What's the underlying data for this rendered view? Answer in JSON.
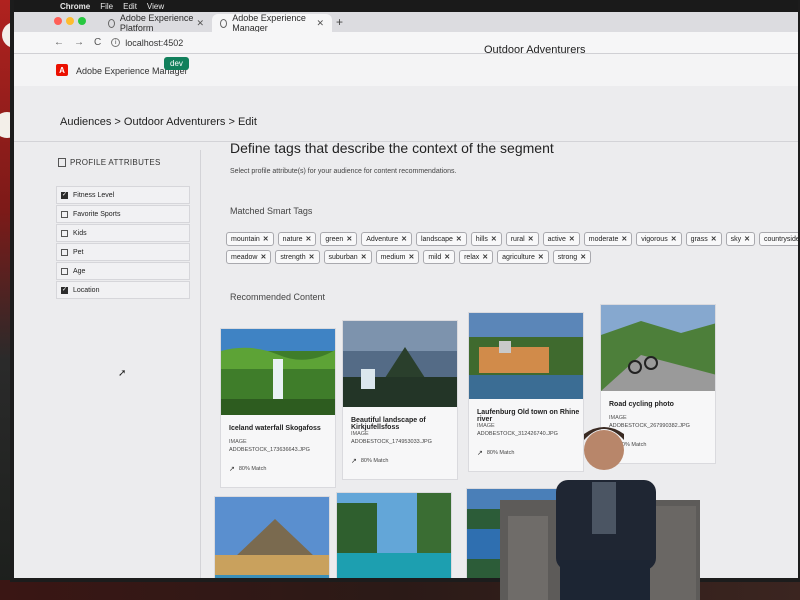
{
  "menubar": {
    "apple": "",
    "items": [
      "Chrome",
      "File",
      "Edit",
      "View"
    ]
  },
  "tabs": [
    {
      "label": "Adobe Experience Platform",
      "close": "✕"
    },
    {
      "label": "Adobe Experience Manager",
      "close": "✕"
    }
  ],
  "newtab": "+",
  "urlbar": {
    "back": "←",
    "forward": "→",
    "reload": "C",
    "info": "i",
    "url": "localhost:4502"
  },
  "header": {
    "logo": "A",
    "product": "Adobe Experience Manager",
    "env": "dev",
    "title": "Outdoor Adventurers"
  },
  "breadcrumb": "Audiences > Outdoor Adventurers > Edit",
  "sidebar": {
    "title": "PROFILE ATTRIBUTES",
    "items": [
      {
        "label": "Fitness Level",
        "checked": true,
        "mark": "✓"
      },
      {
        "label": "Favorite Sports",
        "checked": false,
        "mark": ""
      },
      {
        "label": "Kids",
        "checked": false,
        "mark": ""
      },
      {
        "label": "Pet",
        "checked": false,
        "mark": ""
      },
      {
        "label": "Age",
        "checked": false,
        "mark": ""
      },
      {
        "label": "Location",
        "checked": true,
        "mark": "✓"
      }
    ]
  },
  "main": {
    "heading": "Define tags that describe the context of the segment",
    "subheading": "Select profile attribute(s) for your audience for content recommendations.",
    "tags_title": "Matched Smart Tags",
    "tags_row1": [
      "mountain",
      "nature",
      "green",
      "Adventure",
      "landscape",
      "hills",
      "rural",
      "active",
      "moderate",
      "vigorous",
      "grass",
      "sky",
      "countryside"
    ],
    "tags_row2": [
      "meadow",
      "strength",
      "suburban",
      "medium",
      "mild",
      "relax",
      "agriculture",
      "strong"
    ],
    "tag_remove": "✕",
    "content_title": "Recommended Content",
    "cards": [
      {
        "title": "Iceland waterfall Skogafoss",
        "type": "IMAGE",
        "file": "ADOBESTOCK_173636643.JPG",
        "match": "80% Match"
      },
      {
        "title": "Beautiful landscape of Kirkjufellsfoss",
        "type": "IMAGE",
        "file": "ADOBESTOCK_174953033.JPG",
        "match": "80% Match"
      },
      {
        "title": "Laufenburg Old town on Rhine river",
        "type": "IMAGE",
        "file": "ADOBESTOCK_312426740.JPG",
        "match": "80% Match"
      },
      {
        "title": "Road cycling photo",
        "type": "IMAGE",
        "file": "ADOBESTOCK_267990382.JPG",
        "match": "80% Match"
      }
    ],
    "match_icon": "↗"
  },
  "icons": {
    "traffic": [
      "close-dot",
      "minimize-dot",
      "maximize-dot"
    ]
  },
  "colors": {
    "accent": "#12805c",
    "adobe_red": "#eb1000",
    "traffic": [
      "#ff5f57",
      "#febc2e",
      "#28c840"
    ]
  }
}
